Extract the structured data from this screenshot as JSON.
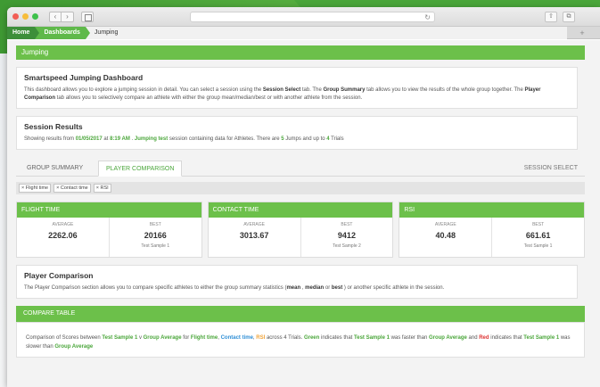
{
  "browser": {
    "nav_back": "‹",
    "nav_forward": "›",
    "reload": "↻",
    "share": "⇧",
    "tabs": "⧉",
    "new_tab": "+"
  },
  "breadcrumb": {
    "home": "Home",
    "dashboards": "Dashboards",
    "current": "Jumping"
  },
  "page_header": "Jumping",
  "intro": {
    "title": "Smartspeed Jumping Dashboard",
    "text1": "This dashboard allows you to explore a jumping session in detail. You can select a session using the ",
    "session_select": "Session Select",
    "text2": " tab. The ",
    "group_summary": "Group Summary",
    "text3": " tab allows you to view the results of the whole group together. The ",
    "player_comparison": "Player Comparison",
    "text4": " tab allows you to selectively compare an athlete with either the group mean/median/best or with another athlete from the session."
  },
  "session": {
    "title": "Session Results",
    "t1": "Showing results from ",
    "date": "01/05/2017",
    "t2": " at ",
    "time": "8:19 AM",
    "t3": " . ",
    "name": "Jumping test",
    "t4": " session containing data for Athletes. There are ",
    "jumps": "5",
    "t5": " Jumps and up to ",
    "trials": "4",
    "t6": " Trials"
  },
  "tabs": {
    "group_summary": "GROUP SUMMARY",
    "player_comparison": "PLAYER COMPARISON",
    "session_select": "SESSION SELECT"
  },
  "filters": [
    "× Flight time",
    "× Contact time",
    "× RSI"
  ],
  "cards": [
    {
      "title": "FLIGHT TIME",
      "avg_label": "AVERAGE",
      "avg": "2262.06",
      "best_label": "BEST",
      "best": "20166",
      "best_sub": "Test Sample 1"
    },
    {
      "title": "CONTACT TIME",
      "avg_label": "AVERAGE",
      "avg": "3013.67",
      "best_label": "BEST",
      "best": "9412",
      "best_sub": "Test Sample 2"
    },
    {
      "title": "RSI",
      "avg_label": "AVERAGE",
      "avg": "40.48",
      "best_label": "BEST",
      "best": "661.61",
      "best_sub": "Test Sample 1"
    }
  ],
  "player_comparison": {
    "title": "Player Comparison",
    "t1": "The Player Comparison section allows you to compare specific athletes to either the group summary statistics (",
    "mean": "mean",
    "t2": " , ",
    "median": "median",
    "t3": " or ",
    "best": "best",
    "t4": " ) or another specific athlete in the session."
  },
  "compare_table": {
    "header": "COMPARE TABLE",
    "t1": "Comparison of Scores between ",
    "sample1": "Test Sample 1",
    "t2": " v ",
    "group_avg": "Group Average",
    "t3": " for ",
    "flight": "Flight time",
    "t4": ", ",
    "contact": "Contact time",
    "t5": ", ",
    "rsi": "RSI",
    "t6": " across 4 Trials. ",
    "green": "Green",
    "t7": " indicates that ",
    "sample1b": "Test Sample 1",
    "t8": " was faster than ",
    "group_avg_b": "Group Average",
    "t9": " and ",
    "red": "Red",
    "t10": " indicates that ",
    "sample1c": "Test Sample 1",
    "t11": " was slower than ",
    "group_avg_c": "Group Average"
  }
}
